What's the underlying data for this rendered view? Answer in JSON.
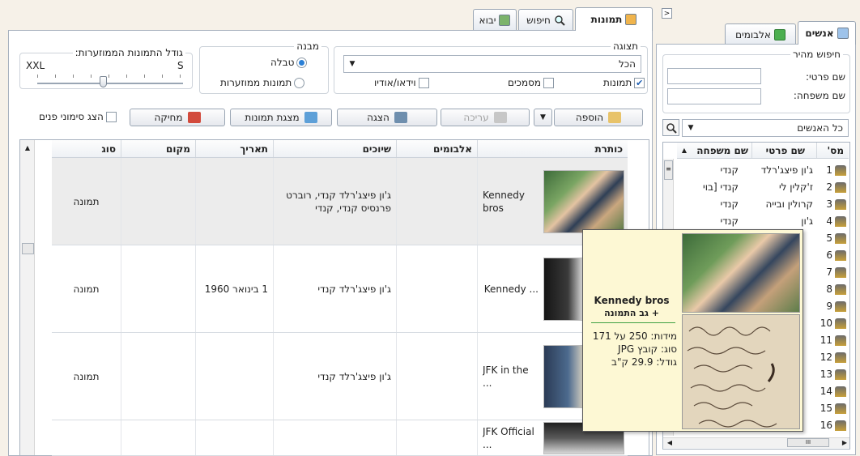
{
  "right_panel": {
    "tabs": [
      {
        "label": "אנשים",
        "active": true
      },
      {
        "label": "אלבומים",
        "active": false
      }
    ],
    "quick_search_title": "חיפוש מהיר",
    "first_name_label": "שם פרטי:",
    "last_name_label": "שם משפחה:",
    "people_combo": "כל האנשים",
    "people_headers": [
      "מס'",
      "שם פרטי",
      "שם משפחה"
    ],
    "people": [
      {
        "no": "1",
        "first": "ג'ון פיצג'רלד",
        "last": "קנדי"
      },
      {
        "no": "2",
        "first": "ז'קלין לי",
        "last": "קנדי [בוי"
      },
      {
        "no": "3",
        "first": "קרולין ובייה",
        "last": "קנדי"
      },
      {
        "no": "4",
        "first": "ג'ון",
        "last": "קנדי"
      },
      {
        "no": "5",
        "first": "",
        "last": ""
      },
      {
        "no": "6",
        "first": "",
        "last": ""
      },
      {
        "no": "7",
        "first": "",
        "last": ""
      },
      {
        "no": "8",
        "first": "",
        "last": ""
      },
      {
        "no": "9",
        "first": "",
        "last": ""
      },
      {
        "no": "10",
        "first": "",
        "last": ""
      },
      {
        "no": "11",
        "first": "",
        "last": ""
      },
      {
        "no": "12",
        "first": "",
        "last": ""
      },
      {
        "no": "13",
        "first": "",
        "last": ""
      },
      {
        "no": "14",
        "first": "",
        "last": ""
      },
      {
        "no": "15",
        "first": "",
        "last": ""
      },
      {
        "no": "16",
        "first": "",
        "last": ""
      }
    ],
    "hscroll_thumb": "III"
  },
  "main_tabs": [
    {
      "label": "תמונות",
      "active": true
    },
    {
      "label": "חיפוש",
      "active": false
    },
    {
      "label": "יבוא",
      "active": false
    }
  ],
  "display_group": {
    "title": "תצוגה",
    "combo_value": "הכל",
    "checks": [
      {
        "label": "תמונות",
        "checked": true
      },
      {
        "label": "מסמכים",
        "checked": false
      },
      {
        "label": "וידאו/אודיו",
        "checked": false
      }
    ]
  },
  "structure_group": {
    "title": "מבנה",
    "options": [
      {
        "label": "טבלה",
        "selected": true
      },
      {
        "label": "תמונות ממוזערות",
        "selected": false
      }
    ]
  },
  "thumb_size_group": {
    "title": "גודל התמונות הממוזערות:",
    "max_label": "XXL",
    "min_label": "S",
    "level_percent": 55
  },
  "toolbar": {
    "add_label": "הוספה",
    "edit_label": "עריכה",
    "view_label": "הצגה",
    "slideshow_label": "מצגת תמונות",
    "delete_label": "מחיקה",
    "show_faces_label": "הצג סימוני פנים"
  },
  "grid": {
    "headers": [
      "כותרת",
      "אלבומים",
      "שיוכים",
      "תאריך",
      "מקום",
      "סוג"
    ],
    "rows": [
      {
        "title": "Kennedy bros",
        "albums": "",
        "links": "ג'ון פיצג'רלד קנדי, רוברט פרנסיס קנדי, קנדי",
        "date": "",
        "place": "",
        "type": "תמונה",
        "selected": true
      },
      {
        "title": "Kennedy ...",
        "albums": "",
        "links": "ג'ון פיצג'רלד קנדי",
        "date": "1 בינואר 1960",
        "place": "",
        "type": "תמונה",
        "selected": false
      },
      {
        "title": "JFK in the ...",
        "albums": "",
        "links": "ג'ון פיצג'רלד קנדי",
        "date": "",
        "place": "",
        "type": "תמונה",
        "selected": false
      },
      {
        "title": "JFK Official ...",
        "albums": "",
        "links": "",
        "date": "",
        "place": "",
        "type": "",
        "selected": false
      }
    ]
  },
  "tooltip": {
    "title": "Kennedy bros",
    "subtitle": "+ גב התמונה",
    "dimensions": "מידות: 250 על 171",
    "type": "סוג: קובץ JPG",
    "size": "גודל: 29.9 ק\"ב"
  }
}
